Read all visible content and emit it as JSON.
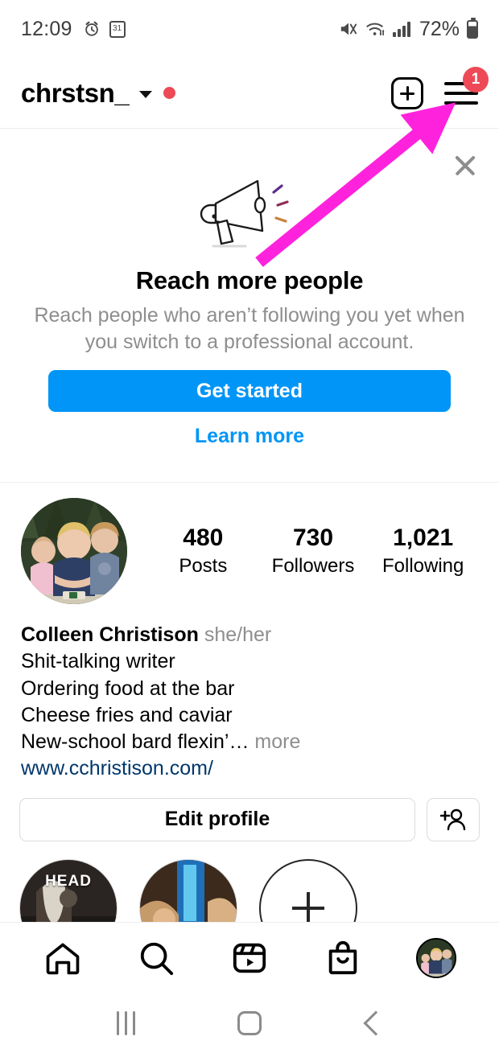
{
  "status_bar": {
    "time": "12:09",
    "battery_percent": "72%",
    "icons": [
      "alarm-icon",
      "calendar-icon",
      "mute-vibrate-icon",
      "wifi-icon",
      "signal-icon",
      "battery-icon"
    ],
    "calendar_day": "31"
  },
  "header": {
    "username": "chrstsn_",
    "notification_count": "1",
    "icons": [
      "chevron-down-icon",
      "status-dot-icon",
      "new-post-icon",
      "menu-icon"
    ]
  },
  "promo": {
    "title": "Reach more people",
    "subtitle": "Reach people who aren’t following you yet when you switch to a professional account.",
    "primary_button": "Get started",
    "secondary_link": "Learn more",
    "illustration": "megaphone-icon",
    "close": "close-icon"
  },
  "profile": {
    "avatar": "profile-avatar",
    "stats": [
      {
        "value": "480",
        "label": "Posts"
      },
      {
        "value": "730",
        "label": "Followers"
      },
      {
        "value": "1,021",
        "label": "Following"
      }
    ],
    "display_name": "Colleen Christison",
    "pronouns": "she/her",
    "bio_lines": [
      "Shit-talking writer",
      "Ordering food at the bar",
      "Cheese fries and caviar"
    ],
    "bio_last_line": "New-school bard flexin’…",
    "more_label": " more",
    "website": "www.cchristison.com/",
    "edit_button": "Edit profile",
    "add_person_button": "add-person-icon"
  },
  "highlights": [
    {
      "caption": "HEAD",
      "type": "photo"
    },
    {
      "caption": "",
      "type": "photo"
    },
    {
      "caption": "",
      "type": "new"
    }
  ],
  "bottom_nav": [
    {
      "name": "home-icon"
    },
    {
      "name": "search-icon"
    },
    {
      "name": "reels-icon"
    },
    {
      "name": "shop-icon"
    },
    {
      "name": "profile-avatar-icon"
    }
  ],
  "system_nav": [
    {
      "name": "recents-button"
    },
    {
      "name": "home-button"
    },
    {
      "name": "back-button"
    }
  ],
  "annotation": {
    "type": "arrow",
    "color": "#ff22dd",
    "points_to": "menu-icon"
  },
  "colors": {
    "accent_blue": "#0095f6",
    "link_blue": "#00376b",
    "red_badge": "#ed4956",
    "muted_gray": "#8e8e8e",
    "divider": "#efefef"
  }
}
